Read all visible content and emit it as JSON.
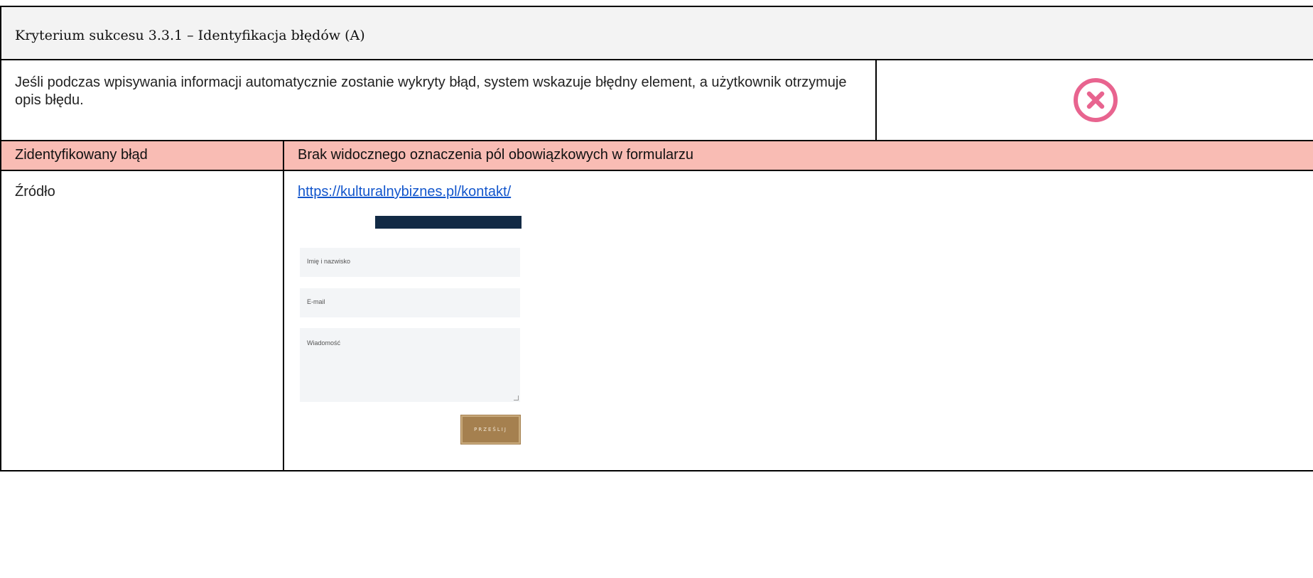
{
  "header": {
    "title": "Kryterium sukcesu 3.3.1 – Identyfikacja błędów (A)"
  },
  "criterion": {
    "description": "Jeśli podczas wpisywania informacji automatycznie zostanie wykryty błąd, system wskazuje błędny element, a użytkownik otrzymuje opis błędu.",
    "status_icon": "x-circle-icon",
    "status_color": "#e8648f"
  },
  "error_row": {
    "label": "Zidentyfikowany błąd",
    "value": "Brak widocznego oznaczenia pól obowiązkowych w formularzu",
    "background": "#f9bcb4"
  },
  "source_row": {
    "label": "Źródło",
    "url": "https://kulturalnybiznes.pl/kontakt/"
  },
  "form_screenshot": {
    "name_placeholder": "Imię i nazwisko",
    "email_placeholder": "E-mail",
    "message_placeholder": "Wiadomość",
    "submit_label": "PRZEŚLIJ",
    "header_bar_color": "#122a45",
    "submit_color": "#a5804f"
  }
}
